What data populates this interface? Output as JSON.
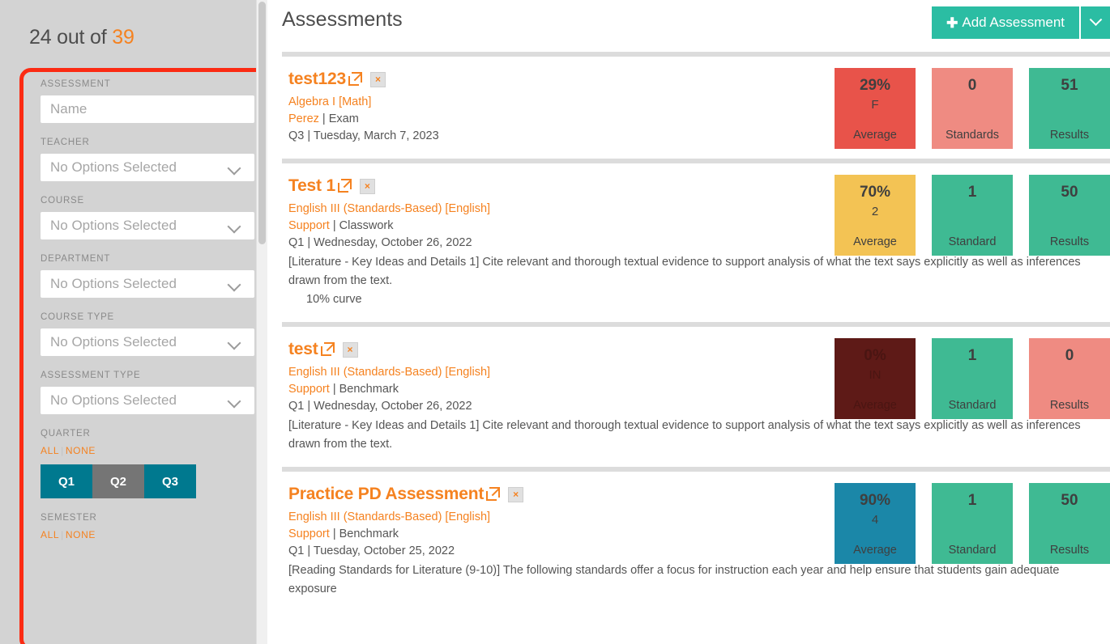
{
  "sidebar": {
    "count_prefix": "24 out of ",
    "count_total": "39",
    "fields": [
      {
        "label": "ASSESSMENT",
        "type": "text",
        "placeholder": "Name",
        "value": ""
      },
      {
        "label": "TEACHER",
        "type": "select",
        "value": "No Options Selected"
      },
      {
        "label": "COURSE",
        "type": "select",
        "value": "No Options Selected"
      },
      {
        "label": "DEPARTMENT",
        "type": "select",
        "value": "No Options Selected"
      },
      {
        "label": "COURSE TYPE",
        "type": "select",
        "value": "No Options Selected"
      },
      {
        "label": "ASSESSMENT TYPE",
        "type": "select",
        "value": "No Options Selected"
      }
    ],
    "quarter": {
      "label": "QUARTER",
      "all_label": "ALL",
      "none_label": "NONE",
      "separator": "|",
      "buttons": [
        {
          "label": "Q1",
          "selected": true
        },
        {
          "label": "Q2",
          "selected": false
        },
        {
          "label": "Q3",
          "selected": true
        }
      ]
    },
    "semester": {
      "label": "SEMESTER",
      "all_label": "ALL",
      "none_label": "NONE",
      "separator": "|"
    }
  },
  "header": {
    "title": "Assessments",
    "add_button": "Add Assessment",
    "add_plus_icon": "plus-icon",
    "add_caret_icon": "chevron-down-icon"
  },
  "assessments": [
    {
      "name": "test123",
      "open_icon": "external-link-icon",
      "delete_icon": "close-x-icon",
      "delete_label": "×",
      "course": "Algebra I [Math]",
      "teacher": "Perez",
      "meta_separator": " | ",
      "type": "Exam",
      "term": "Q3",
      "date": "Tuesday, March 7, 2023",
      "description": "",
      "note": "",
      "tiles": [
        {
          "value": "29%",
          "sub": "F",
          "label": "Average",
          "color": "#e8534a"
        },
        {
          "value": "0",
          "sub": "",
          "label": "Standards",
          "color": "#ef8b82"
        },
        {
          "value": "51",
          "sub": "",
          "label": "Results",
          "color": "#3fba93"
        }
      ]
    },
    {
      "name": "Test 1",
      "open_icon": "external-link-icon",
      "delete_icon": "close-x-icon",
      "delete_label": "×",
      "course": "English III (Standards-Based) [English]",
      "teacher": "Support",
      "meta_separator": " | ",
      "type": "Classwork",
      "term": "Q1",
      "date": "Wednesday, October 26, 2022",
      "description": "[Literature - Key Ideas and Details 1] Cite relevant and thorough textual evidence to support analysis of what the text says explicitly as well as inferences drawn from the text.",
      "note": "10% curve",
      "tiles": [
        {
          "value": "70%",
          "sub": "2",
          "label": "Average",
          "color": "#f3c354"
        },
        {
          "value": "1",
          "sub": "",
          "label": "Standard",
          "color": "#3fba93"
        },
        {
          "value": "50",
          "sub": "",
          "label": "Results",
          "color": "#3fba93"
        }
      ]
    },
    {
      "name": "test",
      "open_icon": "external-link-icon",
      "delete_icon": "close-x-icon",
      "delete_label": "×",
      "course": "English III (Standards-Based) [English]",
      "teacher": "Support",
      "meta_separator": " | ",
      "type": "Benchmark",
      "term": "Q1",
      "date": "Wednesday, October 26, 2022",
      "description": "[Literature - Key Ideas and Details 1] Cite relevant and thorough textual evidence to support analysis of what the text says explicitly as well as inferences drawn from the text.",
      "note": "",
      "tiles": [
        {
          "value": "0%",
          "sub": "IN",
          "label": "Average",
          "color": "#5e1a17",
          "dark": true
        },
        {
          "value": "1",
          "sub": "",
          "label": "Standard",
          "color": "#3fba93"
        },
        {
          "value": "0",
          "sub": "",
          "label": "Results",
          "color": "#ef8b82"
        }
      ]
    },
    {
      "name": "Practice PD Assessment",
      "open_icon": "external-link-icon",
      "delete_icon": "close-x-icon",
      "delete_label": "×",
      "course": "English III (Standards-Based) [English]",
      "teacher": "Support",
      "meta_separator": " | ",
      "type": "Benchmark",
      "term": "Q1",
      "date": "Tuesday, October 25, 2022",
      "description": "[Reading Standards for Literature (9-10)] The following standards offer a focus for instruction each year and help ensure that students gain adequate exposure",
      "note": "",
      "tiles": [
        {
          "value": "90%",
          "sub": "4",
          "label": "Average",
          "color": "#1b87a8"
        },
        {
          "value": "1",
          "sub": "",
          "label": "Standard",
          "color": "#3fba93"
        },
        {
          "value": "50",
          "sub": "",
          "label": "Results",
          "color": "#3fba93"
        }
      ]
    }
  ],
  "colors": {
    "accent_orange": "#f58220",
    "teal": "#00798f",
    "green": "#2bbda3",
    "highlight_ring": "#fb2b13",
    "sidebar_bg": "#d3d3d3"
  }
}
